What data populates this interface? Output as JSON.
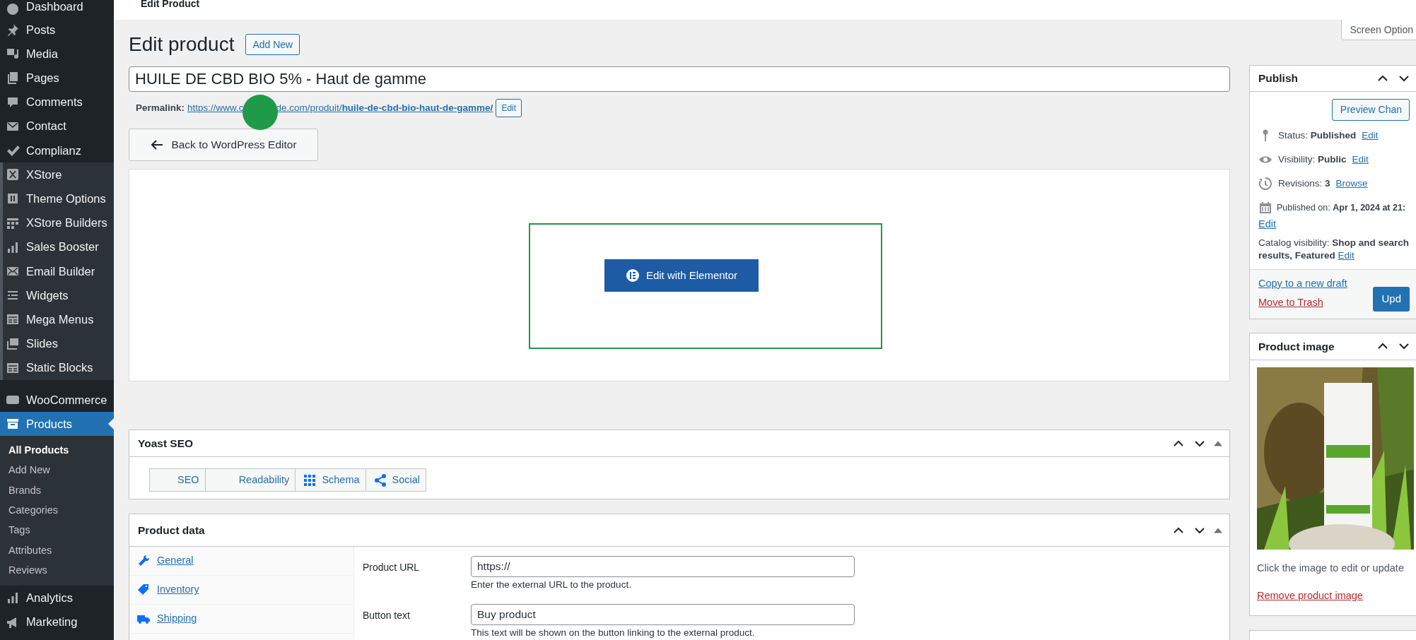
{
  "header": {
    "title": "Edit Product"
  },
  "screen_options": {
    "label": "Screen Option"
  },
  "sidebar": {
    "groups": [
      {
        "shaded": false,
        "items": [
          {
            "label": "Dashboard",
            "selected": false
          },
          {
            "label": "Posts",
            "selected": false
          },
          {
            "label": "Media",
            "selected": false
          },
          {
            "label": "Pages",
            "selected": false
          },
          {
            "label": "Comments",
            "selected": false
          },
          {
            "label": "Contact",
            "selected": false
          },
          {
            "label": "Complianz",
            "selected": false
          }
        ]
      },
      {
        "shaded": true,
        "items": [
          {
            "label": "XStore",
            "selected": false
          },
          {
            "label": "Theme Options",
            "selected": false
          },
          {
            "label": "XStore Builders",
            "selected": false
          },
          {
            "label": "Sales Booster",
            "selected": false
          },
          {
            "label": "Email Builder",
            "selected": false
          },
          {
            "label": "Widgets",
            "selected": false
          },
          {
            "label": "Mega Menus",
            "selected": false
          },
          {
            "label": "Slides",
            "selected": false
          },
          {
            "label": "Static Blocks",
            "selected": false
          }
        ]
      },
      {
        "shaded": false,
        "items": [
          {
            "label": "WooCommerce",
            "selected": false
          },
          {
            "label": "Products",
            "selected": true,
            "children": [
              {
                "label": "All Products",
                "selected": true
              },
              {
                "label": "Add New",
                "selected": false
              },
              {
                "label": "Brands",
                "selected": false
              },
              {
                "label": "Categories",
                "selected": false
              },
              {
                "label": "Tags",
                "selected": false
              },
              {
                "label": "Attributes",
                "selected": false
              },
              {
                "label": "Reviews",
                "selected": false
              }
            ]
          },
          {
            "label": "Analytics",
            "selected": false
          },
          {
            "label": "Marketing",
            "selected": false
          }
        ]
      }
    ]
  },
  "page": {
    "heading": "Edit product",
    "add_new": "Add New",
    "title_value": "HUILE DE CBD BIO 5% - Haut de gamme",
    "permalink": {
      "label": "Permalink:",
      "url_start": "https://www.c",
      "url_rest": "de.com/produit/**huile-de-cbd-bio-haut-de-gamme/**",
      "edit": "Edit"
    },
    "back_button": "Back to WordPress Editor",
    "elementor_button": "Edit with Elementor"
  },
  "yoast": {
    "title": "Yoast SEO",
    "tabs": [
      {
        "label": "SEO",
        "kind": "score"
      },
      {
        "label": "Readability",
        "kind": "score"
      },
      {
        "label": "Schema",
        "kind": "schema"
      },
      {
        "label": "Social",
        "kind": "social"
      }
    ]
  },
  "product_data": {
    "title": "Product data",
    "tabs": [
      {
        "label": "General",
        "kind": "general"
      },
      {
        "label": "Inventory",
        "kind": "inventory"
      },
      {
        "label": "Shipping",
        "kind": "shipping"
      }
    ],
    "fields": [
      {
        "label": "Product URL",
        "value": "https://",
        "help": "Enter the external URL to the product."
      },
      {
        "label": "Button text",
        "value": "Buy product",
        "help": "This text will be shown on the button linking to the external product."
      }
    ]
  },
  "publish": {
    "title": "Publish",
    "preview": "Preview Chan",
    "rows": [
      {
        "kind": "status",
        "text": "Status: **Published**",
        "link": "Edit"
      },
      {
        "kind": "visibility",
        "text": "Visibility: **Public**",
        "link": "Edit"
      },
      {
        "kind": "revisions",
        "text": "Revisions: **3**",
        "link": "Browse"
      },
      {
        "kind": "date",
        "text": "Published on: **Apr 1, 2024 at 21:**",
        "link": "Edit"
      },
      {
        "kind": "catalog",
        "text": "Catalog visibility: **Shop and search results, Featured**",
        "link": "Edit"
      }
    ],
    "copy_link": "Copy to a new draft",
    "trash_link": "Move to Trash",
    "update_button": "Upd"
  },
  "product_image": {
    "title": "Product image",
    "hint": "Click the image to edit or update",
    "remove_link": "Remove product image"
  }
}
